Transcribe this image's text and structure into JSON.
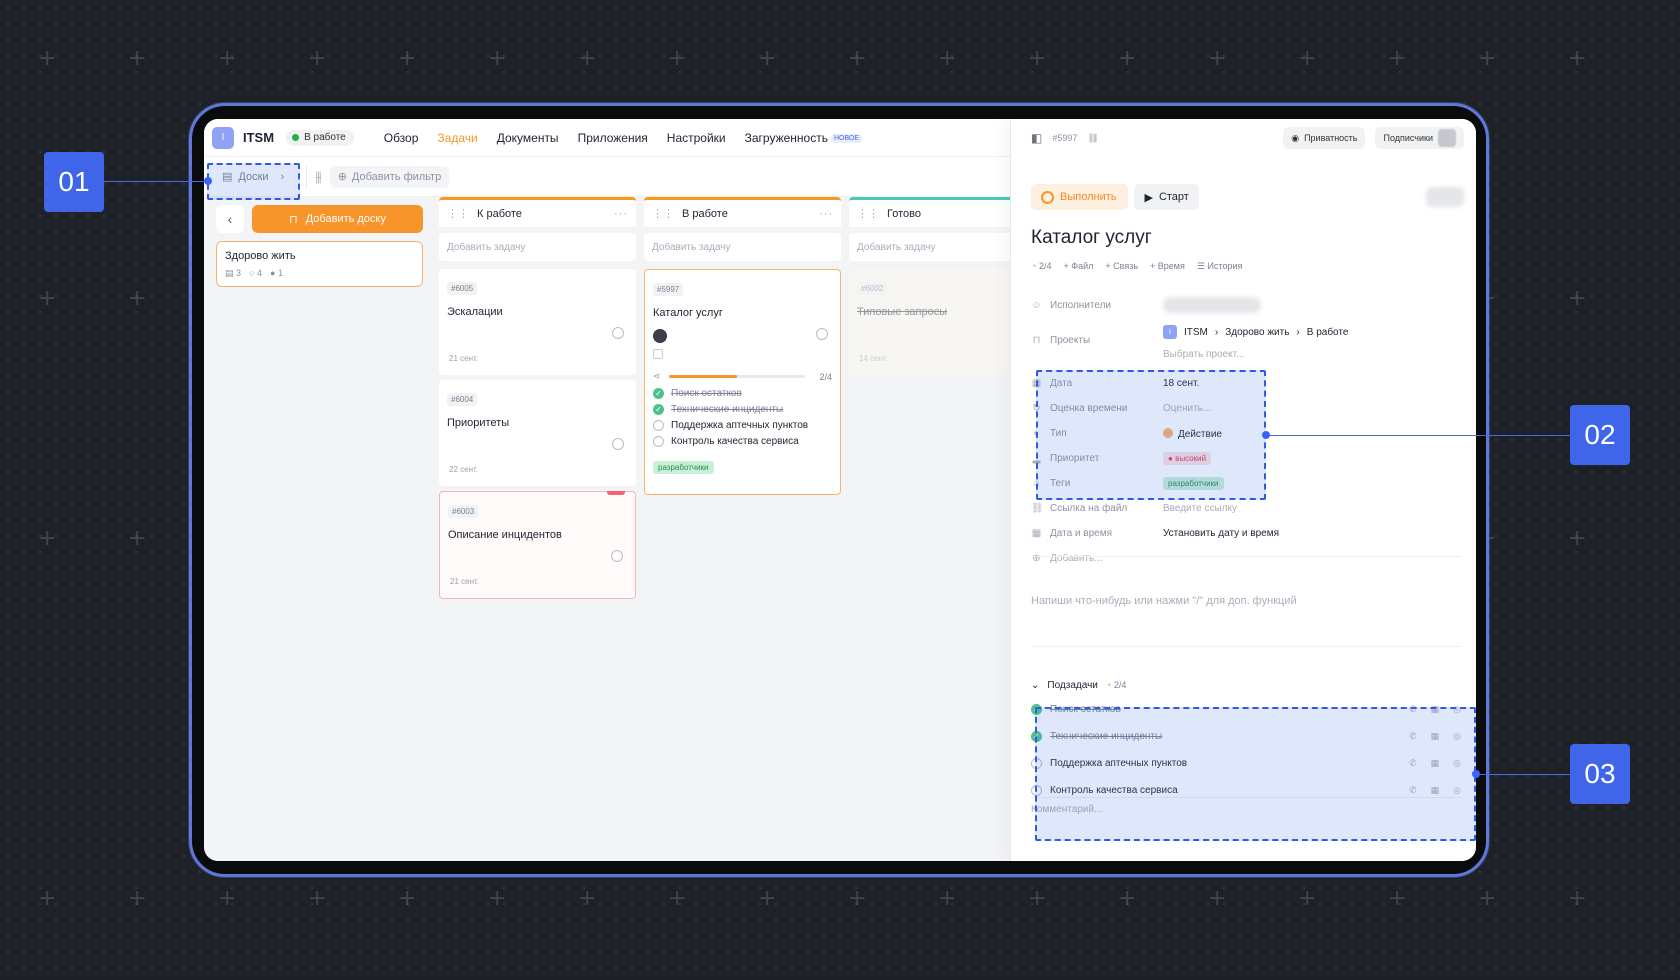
{
  "topbar": {
    "app_initial": "I",
    "app_title": "ITSM",
    "status": "В работе",
    "nav": [
      "Обзор",
      "Задачи",
      "Документы",
      "Приложения",
      "Настройки",
      "Загруженность"
    ],
    "nav_active_index": 1,
    "nav_badge": "НОВОЕ"
  },
  "filterbar": {
    "boards_label": "Доски",
    "add_filter_label": "Добавить фильтр"
  },
  "leftpanel": {
    "add_board_label": "Добавить доску",
    "board": {
      "title": "Здорово жить",
      "meta": [
        "3",
        "4",
        "1"
      ]
    }
  },
  "columns": [
    {
      "title": "К работе",
      "add_task": "Добавить задачу",
      "tasks": [
        {
          "id": "#6005",
          "title": "Эскалации",
          "date": "21 сент."
        },
        {
          "id": "#6004",
          "title": "Приоритеты",
          "date": "22 сент."
        },
        {
          "id": "#6003",
          "title": "Описание инцидентов",
          "date": "21 сент."
        }
      ]
    },
    {
      "title": "В работе",
      "add_task": "Добавить задачу",
      "task": {
        "id": "#5997",
        "title": "Каталог услуг",
        "progress": "2/4",
        "progress_value": 0.5,
        "subtasks": [
          {
            "label": "Поиск остатков",
            "done": true
          },
          {
            "label": "Технические инциденты",
            "done": true
          },
          {
            "label": "Поддержка аптечных пунктов",
            "done": false
          },
          {
            "label": "Контроль качества сервиса",
            "done": false
          }
        ],
        "tag": "разработчики"
      }
    },
    {
      "title": "Готово",
      "add_task": "Добавить задачу",
      "task": {
        "id": "#6002",
        "title": "Типовые запросы",
        "date": "14 сент."
      }
    }
  ],
  "detail": {
    "task_id": "#5997",
    "privacy_label": "Приватность",
    "subscribers_label": "Подписчики",
    "execute_label": "Выполнить",
    "start_label": "Старт",
    "title": "Каталог услуг",
    "actions": [
      "2/4",
      "Файл",
      "Связь",
      "Время",
      "История"
    ],
    "props": {
      "assignees_key": "Исполнители",
      "projects_key": "Проекты",
      "crumbs": [
        "ITSM",
        "Здорово жить",
        "В работе"
      ],
      "choose_project": "Выбрать проект...",
      "date_key": "Дата",
      "date_val": "18 сент.",
      "estimate_key": "Оценка времени",
      "estimate_val": "Оценить...",
      "type_key": "Тип",
      "type_val": "Действие",
      "priority_key": "Приоритет",
      "priority_val": "высокий",
      "tags_key": "Теги",
      "tags_val": "разработчики",
      "filelink_key": "Ссылка на файл",
      "filelink_val": "Введите ссылку",
      "datetime_key": "Дата и время",
      "datetime_val": "Установить дату и время",
      "add_label": "Добавить..."
    },
    "editor_placeholder": "Напиши что-нибудь или нажми \"/\" для доп. функций",
    "subtasks_label": "Подзадачи",
    "subtasks_count": "2/4",
    "subtasks": [
      {
        "label": "Поиск остатков",
        "done": true
      },
      {
        "label": "Технические инциденты",
        "done": true
      },
      {
        "label": "Поддержка аптечных пунктов",
        "done": false
      },
      {
        "label": "Контроль качества сервиса",
        "done": false
      }
    ],
    "comment_placeholder": "Комментарий..."
  },
  "callouts": [
    "01",
    "02",
    "03"
  ],
  "colors": {
    "accent": "#f7952b",
    "callout": "#3f66e8",
    "highlight": "#2f5be0",
    "done": "#4cc38a"
  }
}
